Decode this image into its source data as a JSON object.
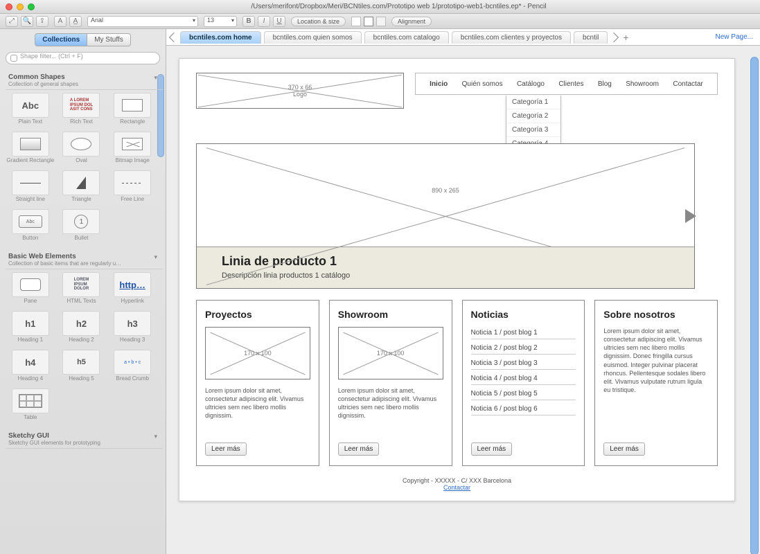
{
  "window": {
    "title": "/Users/merifont/Dropbox/Meri/BCNtiles.com/Prototipo web 1/prototipo-web1-bcntiles.ep* - Pencil"
  },
  "toolbar": {
    "font": "Arial",
    "size": "13",
    "loc_size": "Location & size",
    "alignment": "Alignment"
  },
  "sidebar": {
    "tabs": {
      "collections": "Collections",
      "mystuffs": "My Stuffs"
    },
    "search_placeholder": "Shape filter... (Ctrl + F)",
    "groups": [
      {
        "title": "Common Shapes",
        "subtitle": "Collection of general shapes",
        "items": [
          {
            "label": "Plain Text",
            "glyph": "Abc"
          },
          {
            "label": "Rich Text",
            "glyph": "rich"
          },
          {
            "label": "Rectangle",
            "glyph": "sq"
          },
          {
            "label": "Gradient Rectangle",
            "glyph": "sq"
          },
          {
            "label": "Oval",
            "glyph": "ov"
          },
          {
            "label": "Bitmap Image",
            "glyph": "img"
          },
          {
            "label": "Straight line",
            "glyph": "ln"
          },
          {
            "label": "Triangle",
            "glyph": "tri"
          },
          {
            "label": "Free Line",
            "glyph": "wavy"
          },
          {
            "label": "Button",
            "glyph": "btnshape"
          },
          {
            "label": "Bullet",
            "glyph": "bullet"
          }
        ]
      },
      {
        "title": "Basic Web Elements",
        "subtitle": "Collection of basic items that are regularly u…",
        "items": [
          {
            "label": "Pane",
            "glyph": "sq"
          },
          {
            "label": "HTML Texts",
            "glyph": "rich"
          },
          {
            "label": "Hyperlink",
            "glyph": "link"
          },
          {
            "label": "Heading 1",
            "glyph": "h1"
          },
          {
            "label": "Heading 2",
            "glyph": "h2"
          },
          {
            "label": "Heading 3",
            "glyph": "h3"
          },
          {
            "label": "Heading 4",
            "glyph": "h4"
          },
          {
            "label": "Heading 5",
            "glyph": "h5"
          },
          {
            "label": "Bread Crumb",
            "glyph": "crumb"
          },
          {
            "label": "Table",
            "glyph": "tbl"
          }
        ]
      },
      {
        "title": "Sketchy GUI",
        "subtitle": "Sketchy GUI elements for prototyping",
        "items": []
      }
    ]
  },
  "page_tabs": {
    "items": [
      "bcntiles.com home",
      "bcntiles.com quien somos",
      "bcntiles.com catalogo",
      "bcntiles.com clientes y proyectos",
      "bcntil"
    ],
    "new_page": "New Page..."
  },
  "mock": {
    "logo": {
      "size": "370 x 66",
      "text": "Logo"
    },
    "nav": [
      "Inicio",
      "Quién somos",
      "Catálogo",
      "Clientes",
      "Blog",
      "Showroom",
      "Contactar"
    ],
    "dropdown": [
      "Categoría 1",
      "Categoría 2",
      "Categoría 3",
      "Categoría 4"
    ],
    "hero": {
      "size": "890 x 265",
      "title": "Linia de producto 1",
      "subtitle": "Descripción linia productos 1 catálogo"
    },
    "cards": {
      "proyectos": {
        "title": "Proyectos",
        "img": "170 x 100",
        "text": "Lorem ipsum dolor sit amet, consectetur adipiscing elit. Vivamus ultricies sem nec libero mollis dignissim.",
        "btn": "Leer más"
      },
      "showroom": {
        "title": "Showroom",
        "img": "170 x 100",
        "text": "Lorem ipsum dolor sit amet, consectetur adipiscing elit. Vivamus ultricies sem nec libero mollis dignissim.",
        "btn": "Leer más"
      },
      "noticias": {
        "title": "Noticias",
        "items": [
          "Noticia 1 / post blog 1",
          "Noticia 2 / post blog 2",
          "Noticia 3 / post blog 3",
          "Noticia 4 / post blog 4",
          "Noticia 5 / post blog 5",
          "Noticia 6 / post blog 6"
        ],
        "btn": "Leer más"
      },
      "sobre": {
        "title": "Sobre nosotros",
        "text": "Lorem ipsum dolor sit amet, consectetur adipiscing elit. Vivamus ultricies sem nec libero mollis dignissim. Donec fringilla cursus euismod. Integer pulvinar placerat rhoncus. Pellentesque sodales libero elit. Vivamus vulputate rutrum ligula eu tristique.",
        "btn": "Leer más"
      }
    },
    "footer": {
      "copy": "Copyright - XXXXX - C/ XXX Barcelona",
      "link": "Contactar"
    }
  }
}
